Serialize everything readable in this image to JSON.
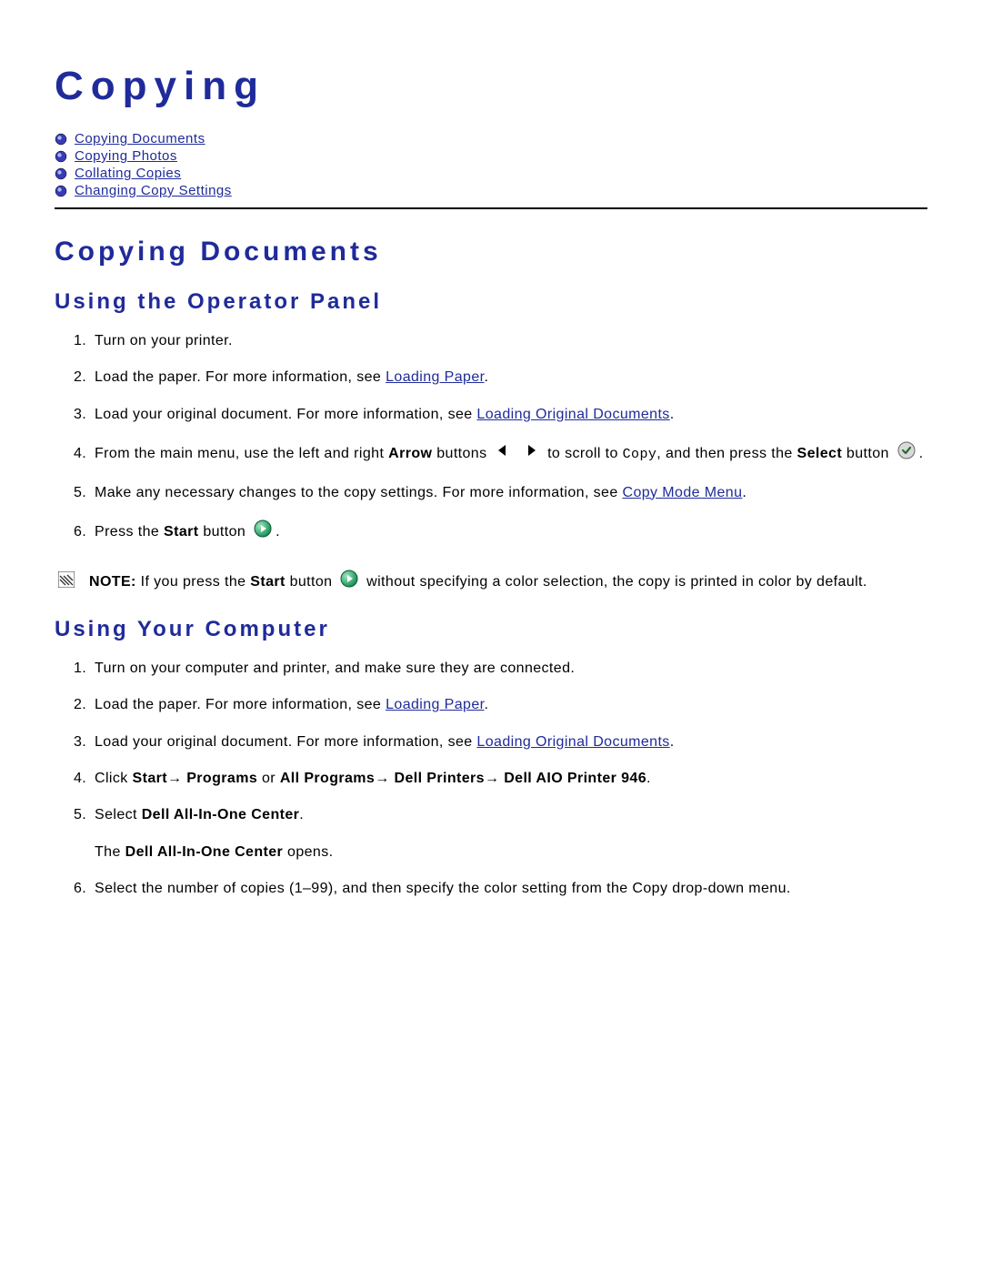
{
  "page": {
    "title": "Copying"
  },
  "toc": {
    "items": [
      {
        "label": "Copying Documents"
      },
      {
        "label": "Copying Photos"
      },
      {
        "label": "Collating Copies"
      },
      {
        "label": "Changing Copy Settings"
      }
    ]
  },
  "section1": {
    "title": "Copying Documents",
    "sub1": {
      "title": "Using the Operator Panel",
      "steps": {
        "s1": "Turn on your printer.",
        "s2_a": "Load the paper. For more information, see ",
        "s2_link": "Loading Paper",
        "s2_b": ".",
        "s3_a": "Load your original document. For more information, see ",
        "s3_link": "Loading Original Documents",
        "s3_b": ".",
        "s4_a": "From the main menu, use the left and right ",
        "s4_bold": "Arrow",
        "s4_b": " buttons ",
        "s4_c": " to scroll to ",
        "s4_mono": "Copy",
        "s4_d": ", and then press the ",
        "s4_bold2": "Select",
        "s4_e": " button ",
        "s4_f": ".",
        "s5_a": "Make any necessary changes to the copy settings. For more information, see ",
        "s5_link": "Copy Mode Menu",
        "s5_b": ".",
        "s6_a": "Press the ",
        "s6_bold": "Start",
        "s6_b": " button ",
        "s6_c": "."
      },
      "note": {
        "lead": "NOTE: ",
        "a": "If you press the ",
        "bold": "Start",
        "b": " button ",
        "c": " without specifying a color selection, the copy is printed in color by default."
      }
    },
    "sub2": {
      "title": "Using Your Computer",
      "steps": {
        "s1": "Turn on your computer and printer, and make sure they are connected.",
        "s2_a": "Load the paper. For more information, see ",
        "s2_link": "Loading Paper",
        "s2_b": ".",
        "s3_a": "Load your original document. For more information, see ",
        "s3_link": "Loading Original Documents",
        "s3_b": ".",
        "s4_a": "Click ",
        "s4_b1": "Start",
        "s4_arrow": "→ ",
        "s4_b2": "Programs",
        "s4_or": " or ",
        "s4_b3": "All Programs",
        "s4_b4": "Dell Printers",
        "s4_b5": "Dell AIO Printer 946",
        "s4_period": ".",
        "s5_a": "Select ",
        "s5_bold": "Dell All-In-One Center",
        "s5_b": ".",
        "s5_sub_a": "The ",
        "s5_sub_bold": "Dell All-In-One Center",
        "s5_sub_b": " opens.",
        "s6": "Select the number of copies (1–99), and then specify the color setting from the Copy drop-down menu."
      }
    }
  }
}
